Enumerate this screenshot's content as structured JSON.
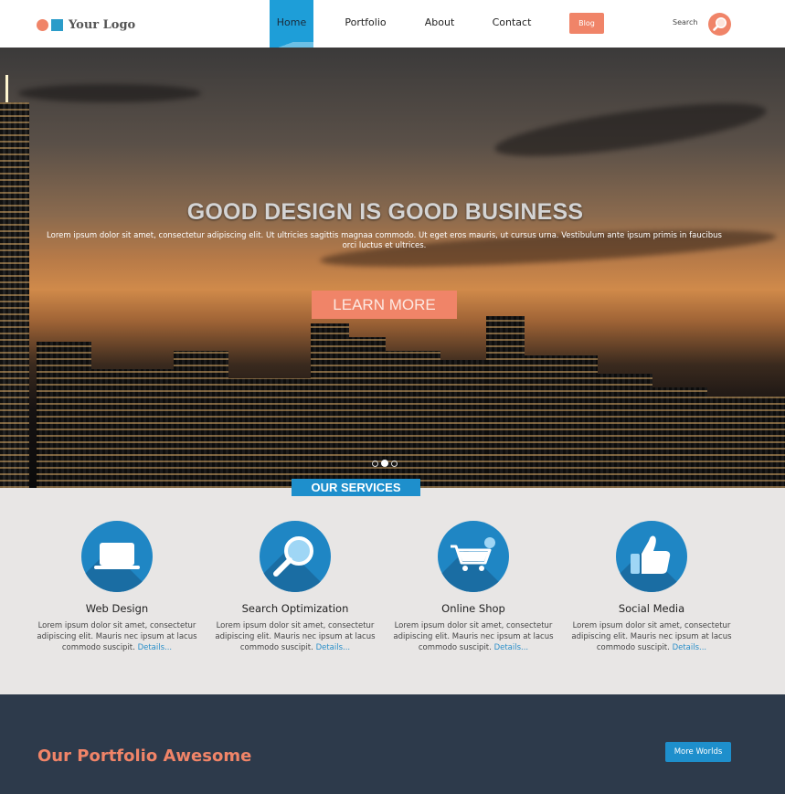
{
  "brand": {
    "logo_text": "Your Logo",
    "accent": "#f08468",
    "primary": "#1e8fcc",
    "dark": "#2d3a4b"
  },
  "nav": {
    "items": [
      {
        "label": "Home",
        "active": true
      },
      {
        "label": "Portfolio",
        "active": false
      },
      {
        "label": "About",
        "active": false
      },
      {
        "label": "Contact",
        "active": false
      }
    ],
    "blog_label": "Blog",
    "search_label": "Search",
    "search_icon": "search-icon"
  },
  "hero": {
    "title": "GOOD DESIGN IS GOOD BUSINESS",
    "text": "Lorem ipsum dolor sit amet, consectetur adipiscing elit. Ut ultricies sagittis magnaa commodo. Ut eget eros mauris, ut cursus urna. Vestibulum ante ipsum primis in faucibus orci luctus et ultrices.",
    "button_label": "LEARN MORE",
    "slides": {
      "count": 3,
      "active": 2
    }
  },
  "services": {
    "heading": "OUR SERVICES",
    "items": [
      {
        "title": "Web Design",
        "icon": "laptop-icon",
        "desc": "Lorem ipsum dolor sit amet, consectetur adipiscing elit. Mauris nec ipsum at lacus commodo suscipit.",
        "link": "Details..."
      },
      {
        "title": "Search Optimization",
        "icon": "magnifier-icon",
        "desc": "Lorem ipsum dolor sit amet, consectetur adipiscing elit. Mauris nec ipsum at lacus commodo suscipit.",
        "link": "Details..."
      },
      {
        "title": "Online Shop",
        "icon": "shopping-cart-icon",
        "desc": "Lorem ipsum dolor sit amet, consectetur adipiscing elit. Mauris nec ipsum at lacus commodo suscipit.",
        "link": "Details..."
      },
      {
        "title": "Social Media",
        "icon": "thumbs-up-icon",
        "desc": "Lorem ipsum dolor sit amet, consectetur adipiscing elit. Mauris nec ipsum at lacus commodo suscipit.",
        "link": "Details..."
      }
    ]
  },
  "portfolio": {
    "title": "Our Portfolio Awesome",
    "button_label": "More Worlds"
  }
}
